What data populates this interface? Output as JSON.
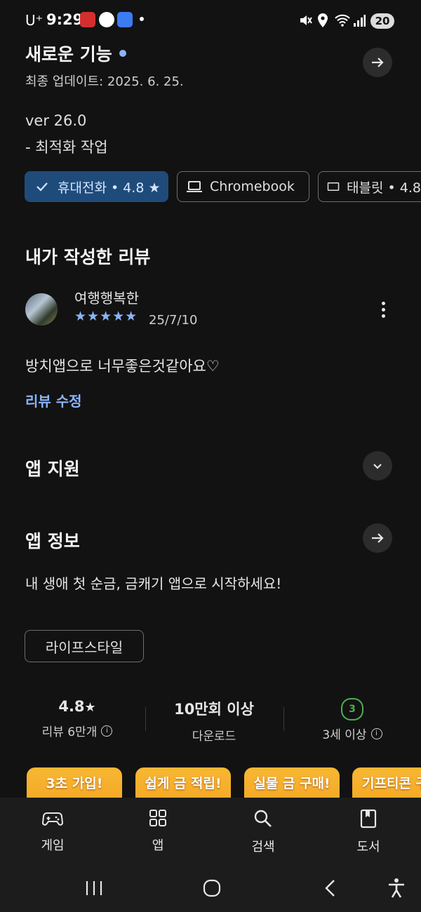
{
  "status": {
    "carrier": "U⁺",
    "time": "9:29",
    "battery": "20"
  },
  "whats_new": {
    "title": "새로운 기능",
    "updated": "최종 업데이트: 2025. 6. 25.",
    "version": "ver 26.0",
    "note": "- 최적화 작업"
  },
  "device_chips": [
    {
      "label": "휴대전화 • 4.8 ★",
      "selected": true
    },
    {
      "label": "Chromebook",
      "selected": false
    },
    {
      "label": "태블릿 • 4.8",
      "selected": false
    }
  ],
  "my_review": {
    "title": "내가 작성한 리뷰",
    "author": "여행행복한",
    "stars": "★★★★★",
    "date": "25/7/10",
    "text": "방치앱으로 너무좋은것같아요♡",
    "edit_label": "리뷰 수정"
  },
  "app_support": {
    "title": "앱 지원"
  },
  "app_info": {
    "title": "앱 정보",
    "description": "내 생애 첫 순금, 금캐기 앱으로 시작하세요!",
    "category": "라이프스타일"
  },
  "stats": {
    "rating": "4.8",
    "rating_star": "★",
    "reviews": "리뷰 6만개",
    "downloads": "10만회 이상",
    "downloads_label": "다운로드",
    "age_badge": "3",
    "age_label": "3세 이상"
  },
  "banners": [
    "3초 가입!",
    "쉽게 금 적립!",
    "실물 금 구매!",
    "기프티콘 구"
  ],
  "bottom_nav": [
    {
      "label": "게임",
      "icon": "gamepad-icon"
    },
    {
      "label": "앱",
      "icon": "apps-grid-icon"
    },
    {
      "label": "검색",
      "icon": "search-icon"
    },
    {
      "label": "도서",
      "icon": "book-icon"
    }
  ],
  "colors": {
    "accent": "#8ab4f8",
    "chip_selected": "#1f4b7a",
    "banner": "#f5a623"
  }
}
